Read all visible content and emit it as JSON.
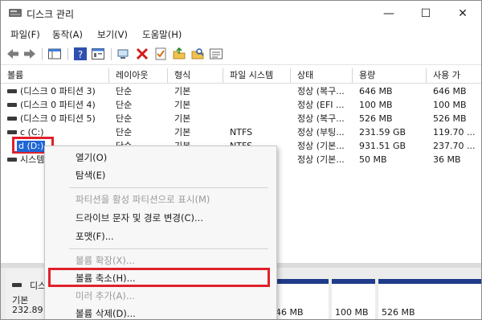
{
  "window": {
    "title": "디스크 관리",
    "minimize": "—",
    "maximize": "☐",
    "close": "✕"
  },
  "menubar": [
    "파일(F)",
    "동작(A)",
    "보기(V)",
    "도움말(H)"
  ],
  "columns": [
    "볼륨",
    "레이아웃",
    "형식",
    "파일 시스템",
    "상태",
    "용량",
    "사용 가"
  ],
  "rows": [
    {
      "volume": "(디스크 0 파티션 3)",
      "layout": "단순",
      "type": "기본",
      "fs": "",
      "status": "정상 (복구...",
      "capacity": "646 MB",
      "used": "646 MB"
    },
    {
      "volume": "(디스크 0 파티션 4)",
      "layout": "단순",
      "type": "기본",
      "fs": "",
      "status": "정상 (EFI ...",
      "capacity": "100 MB",
      "used": "100 MB"
    },
    {
      "volume": "(디스크 0 파티션 5)",
      "layout": "단순",
      "type": "기본",
      "fs": "",
      "status": "정상 (복구...",
      "capacity": "526 MB",
      "used": "526 MB"
    },
    {
      "volume": "c (C:)",
      "layout": "단순",
      "type": "기본",
      "fs": "NTFS",
      "status": "정상 (부팅...",
      "capacity": "231.59 GB",
      "used": "119.70 ..."
    },
    {
      "volume": "d (D:)",
      "layout": "단순",
      "type": "기본",
      "fs": "NTFS",
      "status": "정상 (기본...",
      "capacity": "931.51 GB",
      "used": "237.70 ..."
    },
    {
      "volume": "시스템",
      "layout": "",
      "type": "",
      "fs": "",
      "status": "정상 (기본...",
      "capacity": "50 MB",
      "used": "36 MB"
    }
  ],
  "lower": {
    "disk_label": "디스",
    "disk_type": "기본",
    "disk_size": "232.89",
    "parts": [
      "46 MB",
      "100 MB",
      "526 MB"
    ]
  },
  "context_menu": [
    {
      "label": "열기(O)",
      "enabled": true
    },
    {
      "label": "탐색(E)",
      "enabled": true
    },
    {
      "label": "파티션을 활성 파티션으로 표시(M)",
      "enabled": false
    },
    {
      "label": "드라이브 문자 및 경로 변경(C)...",
      "enabled": true
    },
    {
      "label": "포맷(F)...",
      "enabled": true
    },
    {
      "label": "볼륨 확장(X)...",
      "enabled": false
    },
    {
      "label": "볼륨 축소(H)...",
      "enabled": true
    },
    {
      "label": "미러 추가(A)...",
      "enabled": false
    },
    {
      "label": "볼륨 삭제(D)...",
      "enabled": true
    }
  ],
  "colors": {
    "highlight": "#e0212b",
    "selection": "#1f66d6",
    "disk_bar": "#1f3b8a"
  }
}
